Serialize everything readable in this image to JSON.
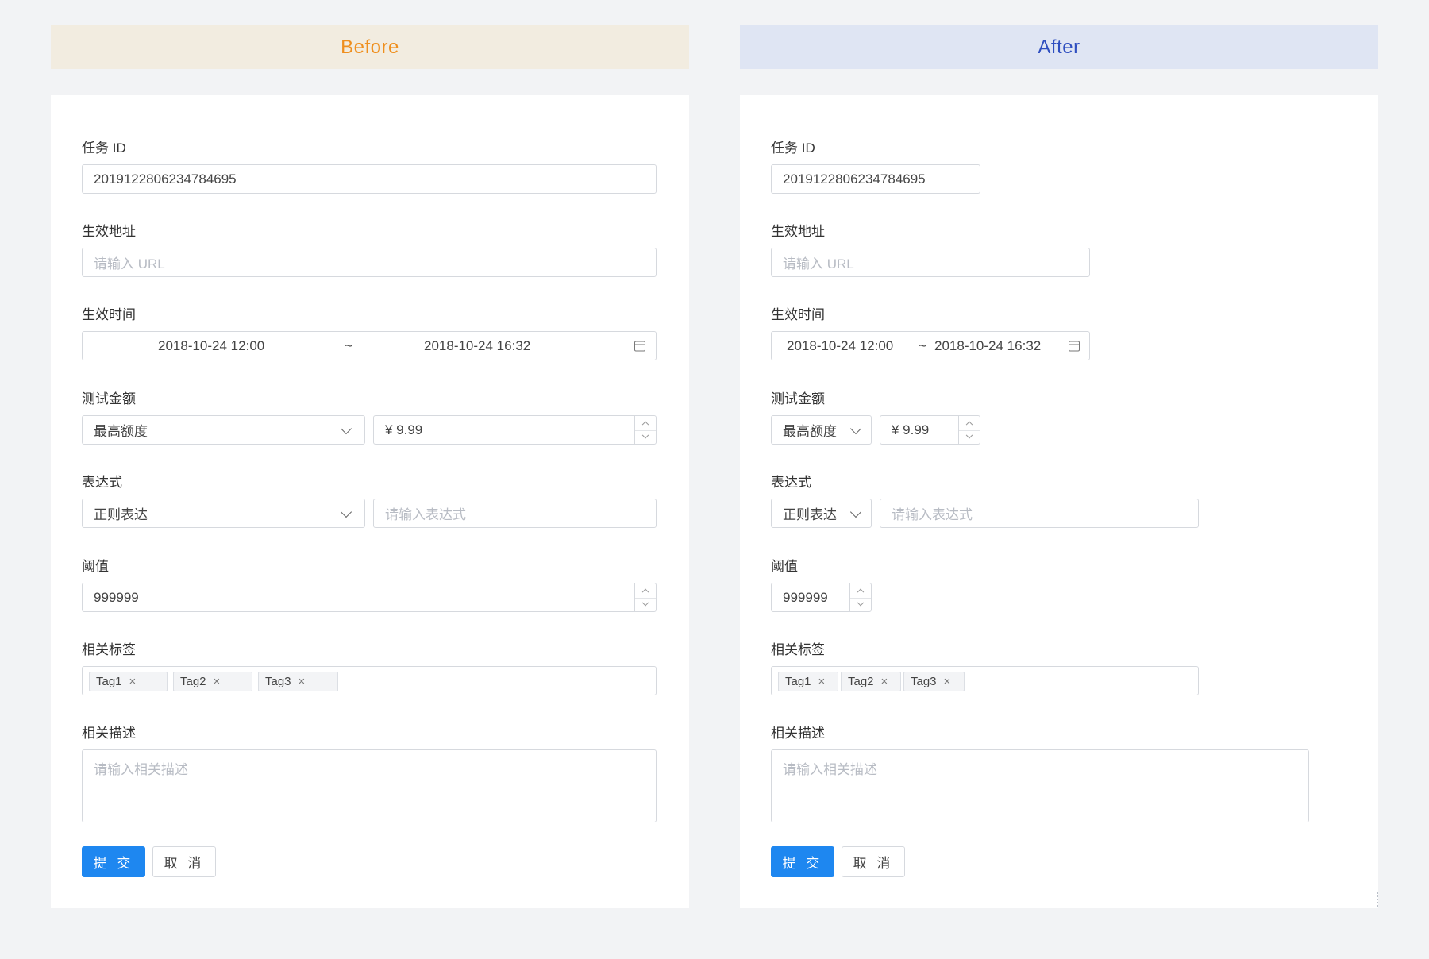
{
  "banners": {
    "before": "Before",
    "after": "After"
  },
  "form": {
    "task_id": {
      "label": "任务 ID",
      "value": "2019122806234784695"
    },
    "url": {
      "label": "生效地址",
      "placeholder": "请输入 URL"
    },
    "time": {
      "label": "生效时间",
      "start": "2018-10-24 12:00",
      "separator": "~",
      "end": "2018-10-24 16:32",
      "icon": "calendar-icon"
    },
    "amount": {
      "label": "测试金额",
      "select": "最高额度",
      "value": "¥ 9.99"
    },
    "expression": {
      "label": "表达式",
      "select": "正则表达",
      "placeholder": "请输入表达式"
    },
    "threshold": {
      "label": "阈值",
      "value": "999999"
    },
    "tags": {
      "label": "相关标签",
      "items": [
        "Tag1",
        "Tag2",
        "Tag3"
      ],
      "remove_glyph": "×"
    },
    "description": {
      "label": "相关描述",
      "placeholder": "请输入相关描述"
    },
    "buttons": {
      "submit": "提 交",
      "cancel": "取 消"
    }
  },
  "colors": {
    "before_accent": "#ef8f1e",
    "after_accent": "#2f4fc0",
    "primary": "#1e87f0"
  }
}
